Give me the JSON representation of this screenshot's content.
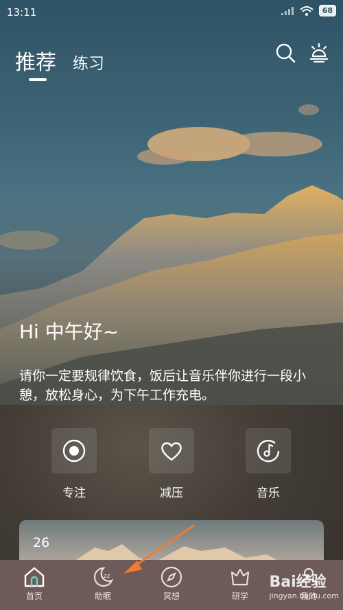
{
  "status_bar": {
    "time": "13:11",
    "battery": "68"
  },
  "header": {
    "tabs": [
      {
        "label": "推荐"
      },
      {
        "label": "练习"
      }
    ]
  },
  "greeting": {
    "title": "Hi 中午好~",
    "message": "请你一定要规律饮食，饭后让音乐伴你进行一段小憩，放松身心，为下午工作充电。"
  },
  "actions": [
    {
      "label": "专注",
      "icon": "target-icon"
    },
    {
      "label": "减压",
      "icon": "heart-icon"
    },
    {
      "label": "音乐",
      "icon": "music-icon"
    }
  ],
  "card": {
    "number": "26"
  },
  "bottom_nav": [
    {
      "label": "首页",
      "icon": "home-icon"
    },
    {
      "label": "助眠",
      "icon": "sleep-icon"
    },
    {
      "label": "冥想",
      "icon": "compass-icon"
    },
    {
      "label": "研学",
      "icon": "crown-icon"
    },
    {
      "label": "我的",
      "icon": "profile-icon"
    }
  ],
  "watermark": {
    "brand": "Bai经验",
    "url": "jingyan.baidu.com"
  },
  "colors": {
    "nav_bg": "#6e5a59",
    "arrow": "#f07a30",
    "accent": "#ffffff"
  }
}
